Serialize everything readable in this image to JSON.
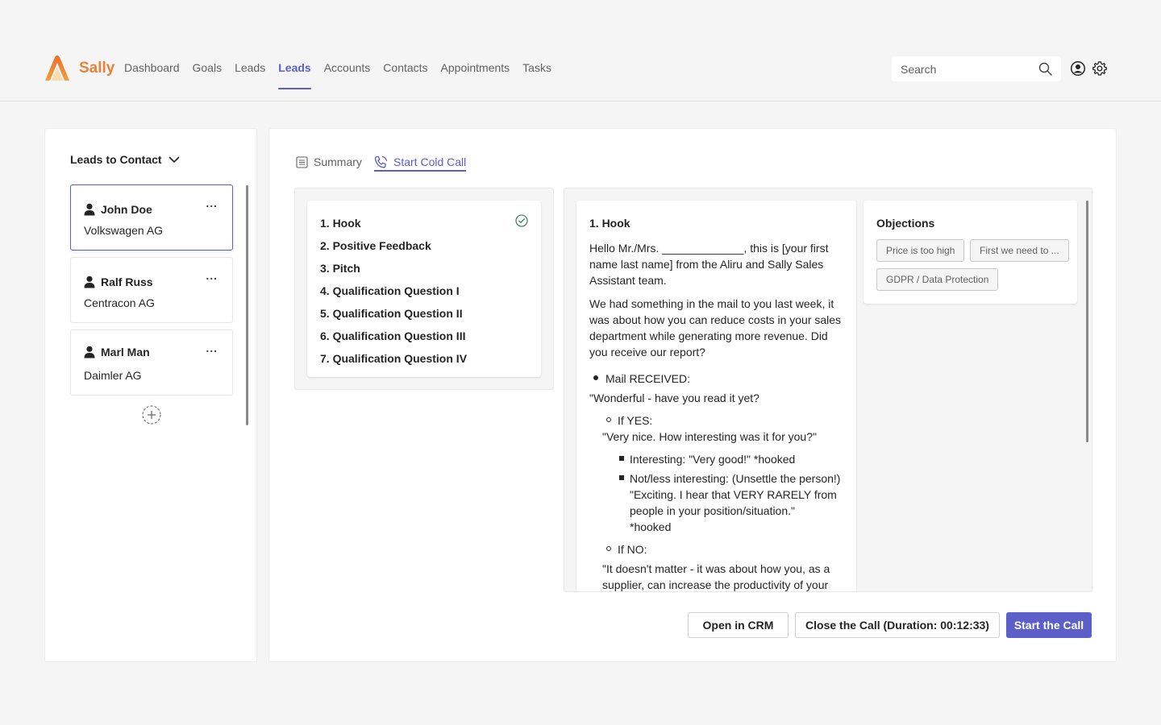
{
  "app": {
    "brand": "Sally",
    "colors": {
      "accent": "#5b5fc7",
      "brand": "#e8833a",
      "success": "#237b4b"
    }
  },
  "nav": {
    "items": [
      "Dashboard",
      "Goals",
      "Leads",
      "Leads",
      "Accounts",
      "Contacts",
      "Appointments",
      "Tasks"
    ],
    "active_index": 3
  },
  "search": {
    "placeholder": "Search",
    "value": ""
  },
  "header_icons": [
    "search-icon",
    "user-icon",
    "gear-icon"
  ],
  "leads_panel": {
    "title": "Leads to Contact",
    "leads": [
      {
        "name": "John Doe",
        "company": "Volkswagen AG",
        "selected": true
      },
      {
        "name": "Ralf Russ",
        "company": "Centracon AG",
        "selected": false
      },
      {
        "name": "Marl Man",
        "company": "Daimler AG",
        "selected": false
      }
    ],
    "more_label": "..."
  },
  "tabs": [
    {
      "label": "Summary",
      "icon": "document-icon",
      "active": false
    },
    {
      "label": "Start Cold Call",
      "icon": "phone-icon",
      "active": true
    }
  ],
  "steps": [
    {
      "label": "1. Hook",
      "done": true
    },
    {
      "label": "2. Positive Feedback",
      "done": false
    },
    {
      "label": "3. Pitch",
      "done": false
    },
    {
      "label": "4. Qualification Question I",
      "done": false
    },
    {
      "label": "5. Qualification Question II",
      "done": false
    },
    {
      "label": "6. Qualification Question III",
      "done": false
    },
    {
      "label": "7. Qualification Question IV",
      "done": false
    }
  ],
  "script": {
    "heading": "1. Hook",
    "p1": [
      "Hello Mr./Mrs. _____________, this is [your first",
      "name last name] from the Aliru and Sally Sales",
      "Assistant team."
    ],
    "p2": [
      "We had something in the mail to you last week, it",
      "was about how you can reduce costs in your sales",
      "department while generating more revenue. Did",
      "you receive our report?"
    ],
    "mail_received": "Mail RECEIVED:",
    "wonderful": "\"Wonderful - have you read it  yet?",
    "if_yes": "If YES:",
    "very_nice": "\"Very nice. How interesting was it for you?\"",
    "interesting": "Interesting: \"Very good!\" *hooked",
    "not_interesting": [
      "Not/less interesting: (Unsettle the person!)",
      "\"Exciting. I hear that VERY RARELY from",
      "people in your position/situation.\"",
      "*hooked"
    ],
    "if_no": "If NO:",
    "doesnt_matter": [
      "\"It doesn't matter - it was about how you, as a",
      "supplier, can increase the productivity of your"
    ]
  },
  "objections": {
    "heading": "Objections",
    "chips": [
      "Price is too high",
      "First we need to ...",
      "GDPR / Data Protection"
    ]
  },
  "actions": {
    "open_crm": "Open in CRM",
    "close_call": "Close the Call (Duration: 00:12:33)",
    "start_call": "Start the Call"
  }
}
